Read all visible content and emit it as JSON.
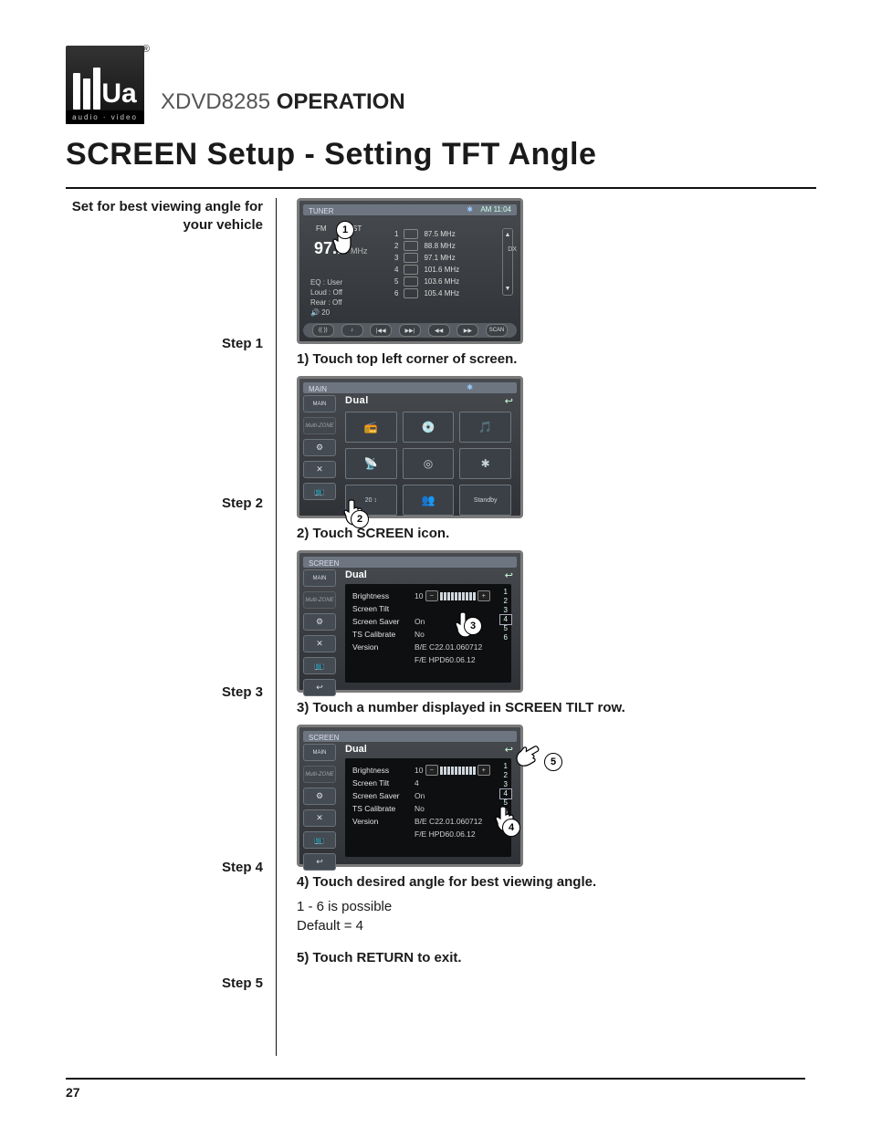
{
  "logo": {
    "brand_letters": "Ua",
    "sub": "audio · video",
    "reg": "®"
  },
  "header": {
    "model": "XDVD8285",
    "word": "OPERATION"
  },
  "page_title": "SCREEN Setup - Setting TFT Angle",
  "intro": "Set for best viewing angle for your vehicle",
  "steps": {
    "s1": "Step 1",
    "s2": "Step 2",
    "s3": "Step 3",
    "s4": "Step 4",
    "s5": "Step 5"
  },
  "captions": {
    "c1": "1) Touch top left corner of screen.",
    "c2": "2) Touch SCREEN icon.",
    "c3": "3) Touch a number displayed in SCREEN TILT row.",
    "c4": "4) Touch desired angle for best viewing angle.",
    "range": "1 - 6  is possible",
    "default": "Default = 4",
    "c5": "5) Touch RETURN to exit."
  },
  "shot1": {
    "crumb": "TUNER",
    "clock": "AM 11:04",
    "bt": "✱",
    "band_fm": "FM",
    "band_st": "ST",
    "freq": "97.1",
    "hz": "MHz",
    "dx": "DX",
    "presets": [
      {
        "n": "1",
        "f": "87.5 MHz"
      },
      {
        "n": "2",
        "f": "88.8 MHz"
      },
      {
        "n": "3",
        "f": "97.1 MHz"
      },
      {
        "n": "4",
        "f": "101.6 MHz"
      },
      {
        "n": "5",
        "f": "103.6 MHz"
      },
      {
        "n": "6",
        "f": "105.4 MHz"
      }
    ],
    "info": {
      "eq": "EQ   : User",
      "loud": "Loud : Off",
      "rear": "Rear : Off",
      "vol_icon": "🔊",
      "vol": "20"
    },
    "bottom": [
      "(( ))",
      "♪",
      "|◀◀",
      "▶▶|",
      "◀◀",
      "▶▶",
      "SCAN"
    ],
    "badge": "1"
  },
  "shot2": {
    "crumb": "MAIN",
    "brand": "Dual",
    "return": "↩",
    "side": [
      "MAIN",
      "Multi-ZONE",
      "⚙",
      "✕",
      "📺"
    ],
    "tiles": [
      {
        "t": "📻",
        "n": "radio-tile"
      },
      {
        "t": "💿",
        "n": "disc-tile"
      },
      {
        "t": "🎵",
        "n": "ipod-tile"
      },
      {
        "t": "📡",
        "n": "xm-tile"
      },
      {
        "t": "◎",
        "n": "target-tile"
      },
      {
        "t": "✱",
        "n": "bluetooth-tile"
      },
      {
        "t": "20 ↕",
        "n": "screen-tile"
      },
      {
        "t": "👥",
        "n": "users-tile"
      },
      {
        "t": "Standby",
        "n": "standby-tile"
      }
    ],
    "badge": "2"
  },
  "shot3": {
    "crumb": "SCREEN",
    "brand": "Dual",
    "return": "↩",
    "side": [
      "MAIN",
      "Multi-ZONE",
      "⚙",
      "✕",
      "📺",
      "↩"
    ],
    "rows": {
      "brightness": {
        "label": "Brightness",
        "val": "10"
      },
      "tilt": {
        "label": "Screen Tilt",
        "val": ""
      },
      "saver": {
        "label": "Screen  Saver",
        "val": "On"
      },
      "ts": {
        "label": "TS Calibrate",
        "val": "No"
      },
      "ver": {
        "label": "Version",
        "v1": "B/E  C22.01.060712",
        "v2": "F/E  HPD60.06.12"
      }
    },
    "nums": [
      "1",
      "2",
      "3",
      "4",
      "5",
      "6"
    ],
    "badge": "3"
  },
  "shot4": {
    "crumb": "SCREEN",
    "brand": "Dual",
    "return": "↩",
    "side": [
      "MAIN",
      "Multi-ZONE",
      "⚙",
      "✕",
      "📺",
      "↩"
    ],
    "rows": {
      "brightness": {
        "label": "Brightness",
        "val": "10"
      },
      "tilt": {
        "label": "Screen Tilt",
        "val": "4"
      },
      "saver": {
        "label": "Screen  Saver",
        "val": "On"
      },
      "ts": {
        "label": "TS Calibrate",
        "val": "No"
      },
      "ver": {
        "label": "Version",
        "v1": "B/E  C22.01.060712",
        "v2": "F/E  HPD60.06.12"
      }
    },
    "nums": [
      "1",
      "2",
      "3",
      "4",
      "5",
      "6"
    ],
    "badge4": "4",
    "badge5": "5"
  },
  "page_number": "27"
}
